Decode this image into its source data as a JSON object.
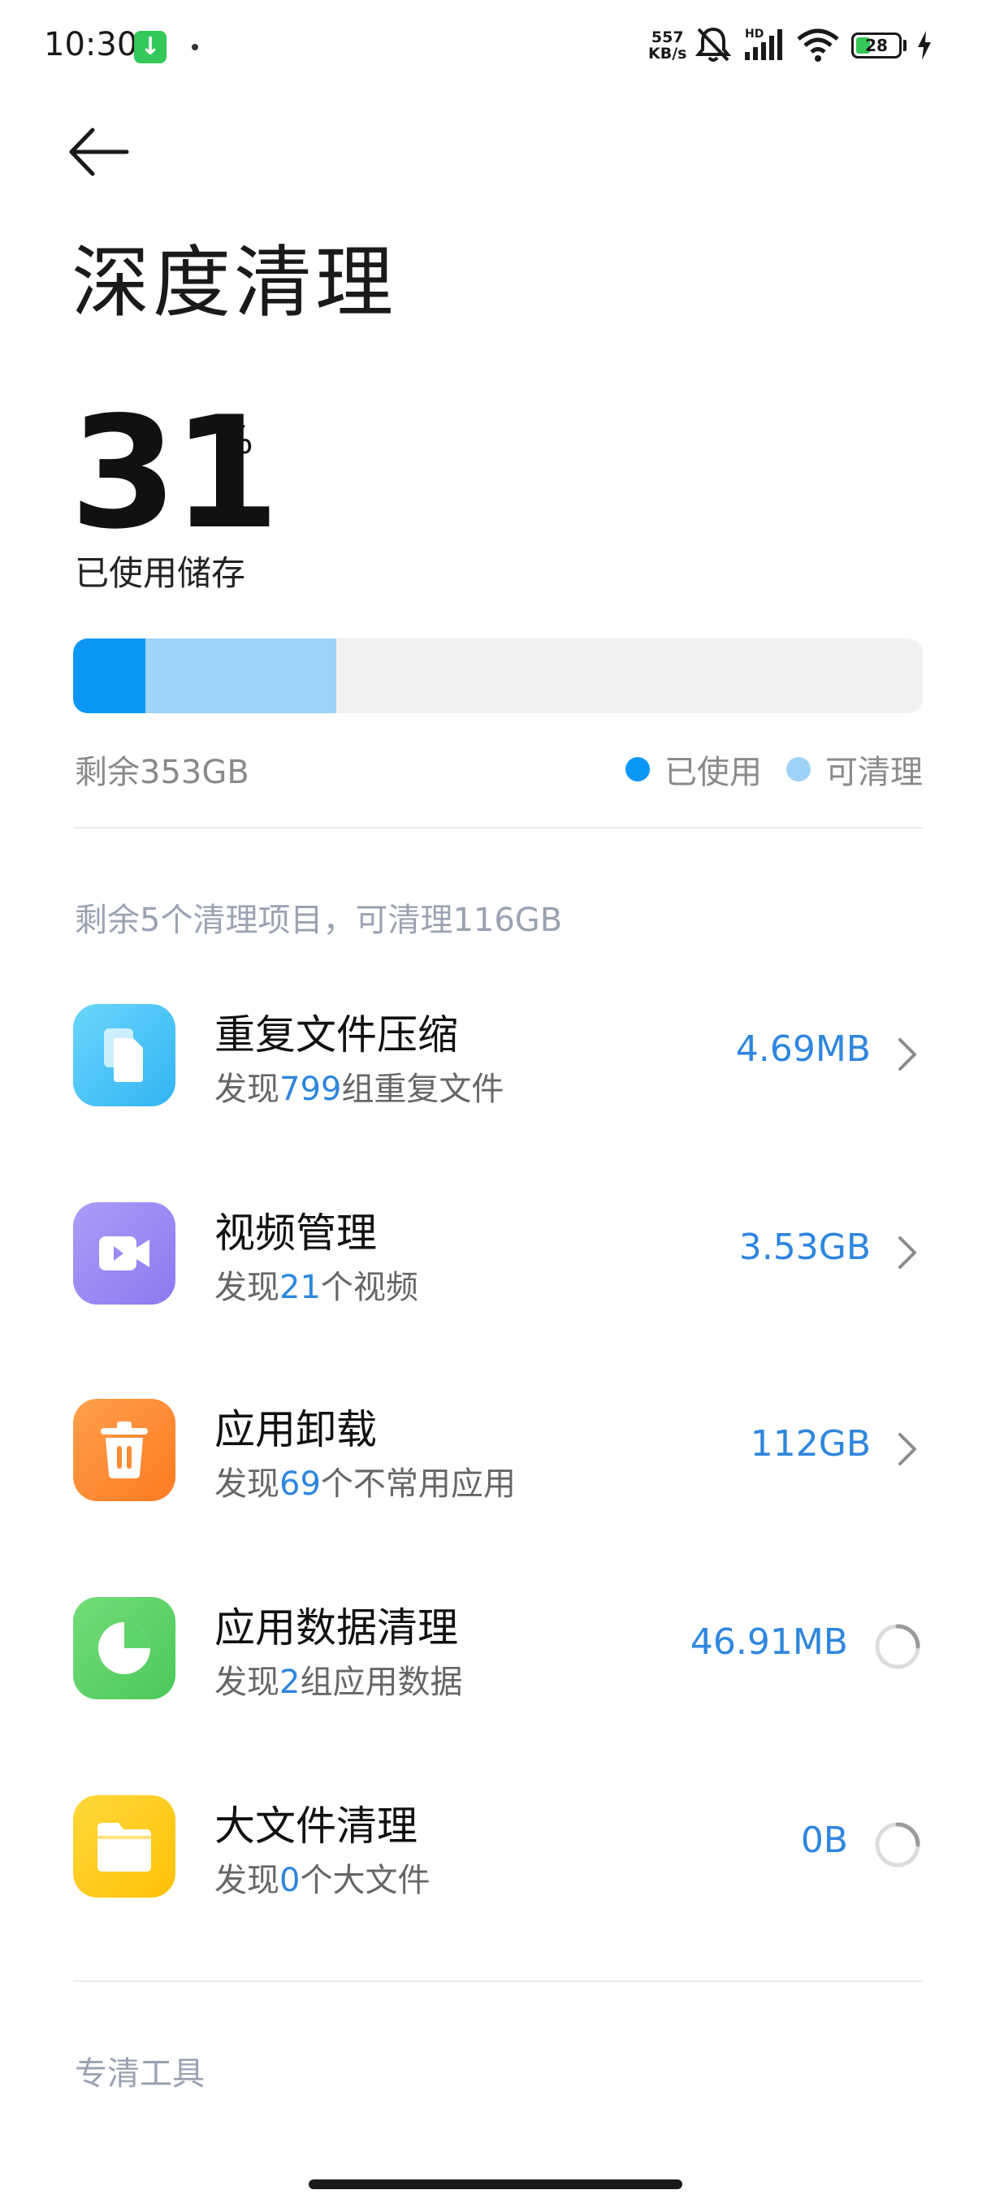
{
  "status_bar": {
    "time": "10:30",
    "net_speed_value": "557",
    "net_speed_unit": "KB/s",
    "battery_level": "28",
    "hd_label": "HD"
  },
  "page": {
    "title": "深度清理"
  },
  "storage": {
    "used_percent": "31",
    "percent_sign": "%",
    "used_caption": "已使用储存",
    "used_fraction": 0.085,
    "cleanable_fraction": 0.225,
    "remaining": "剩余353GB",
    "legend_used": "已使用",
    "legend_cleanable": "可清理",
    "color_used": "#0b97f5",
    "color_cleanable": "#9fd2f7"
  },
  "clean_section": {
    "header": "剩余5个清理项目，可清理116GB",
    "items": [
      {
        "title": "重复文件压缩",
        "sub_prefix": "发现",
        "sub_count": "799",
        "sub_suffix": "组重复文件",
        "size": "4.69MB",
        "icon": "duplicate-files-icon",
        "color": "#4fc3f7",
        "state": "ready"
      },
      {
        "title": "视频管理",
        "sub_prefix": "发现",
        "sub_count": "21",
        "sub_suffix": "个视频",
        "size": "3.53GB",
        "icon": "video-icon",
        "color": "#9b8cf5",
        "state": "ready"
      },
      {
        "title": "应用卸载",
        "sub_prefix": "发现",
        "sub_count": "69",
        "sub_suffix": "个不常用应用",
        "size": "112GB",
        "icon": "trash-icon",
        "color": "#ff8a34",
        "state": "ready"
      },
      {
        "title": "应用数据清理",
        "sub_prefix": "发现",
        "sub_count": "2",
        "sub_suffix": "组应用数据",
        "size": "46.91MB",
        "icon": "pie-chart-icon",
        "color": "#5fd46a",
        "state": "scanning"
      },
      {
        "title": "大文件清理",
        "sub_prefix": "发现",
        "sub_count": "0",
        "sub_suffix": "个大文件",
        "size": "0B",
        "icon": "folder-icon",
        "color": "#ffcc1f",
        "state": "scanning"
      }
    ]
  },
  "tools_section": {
    "header": "专清工具"
  }
}
